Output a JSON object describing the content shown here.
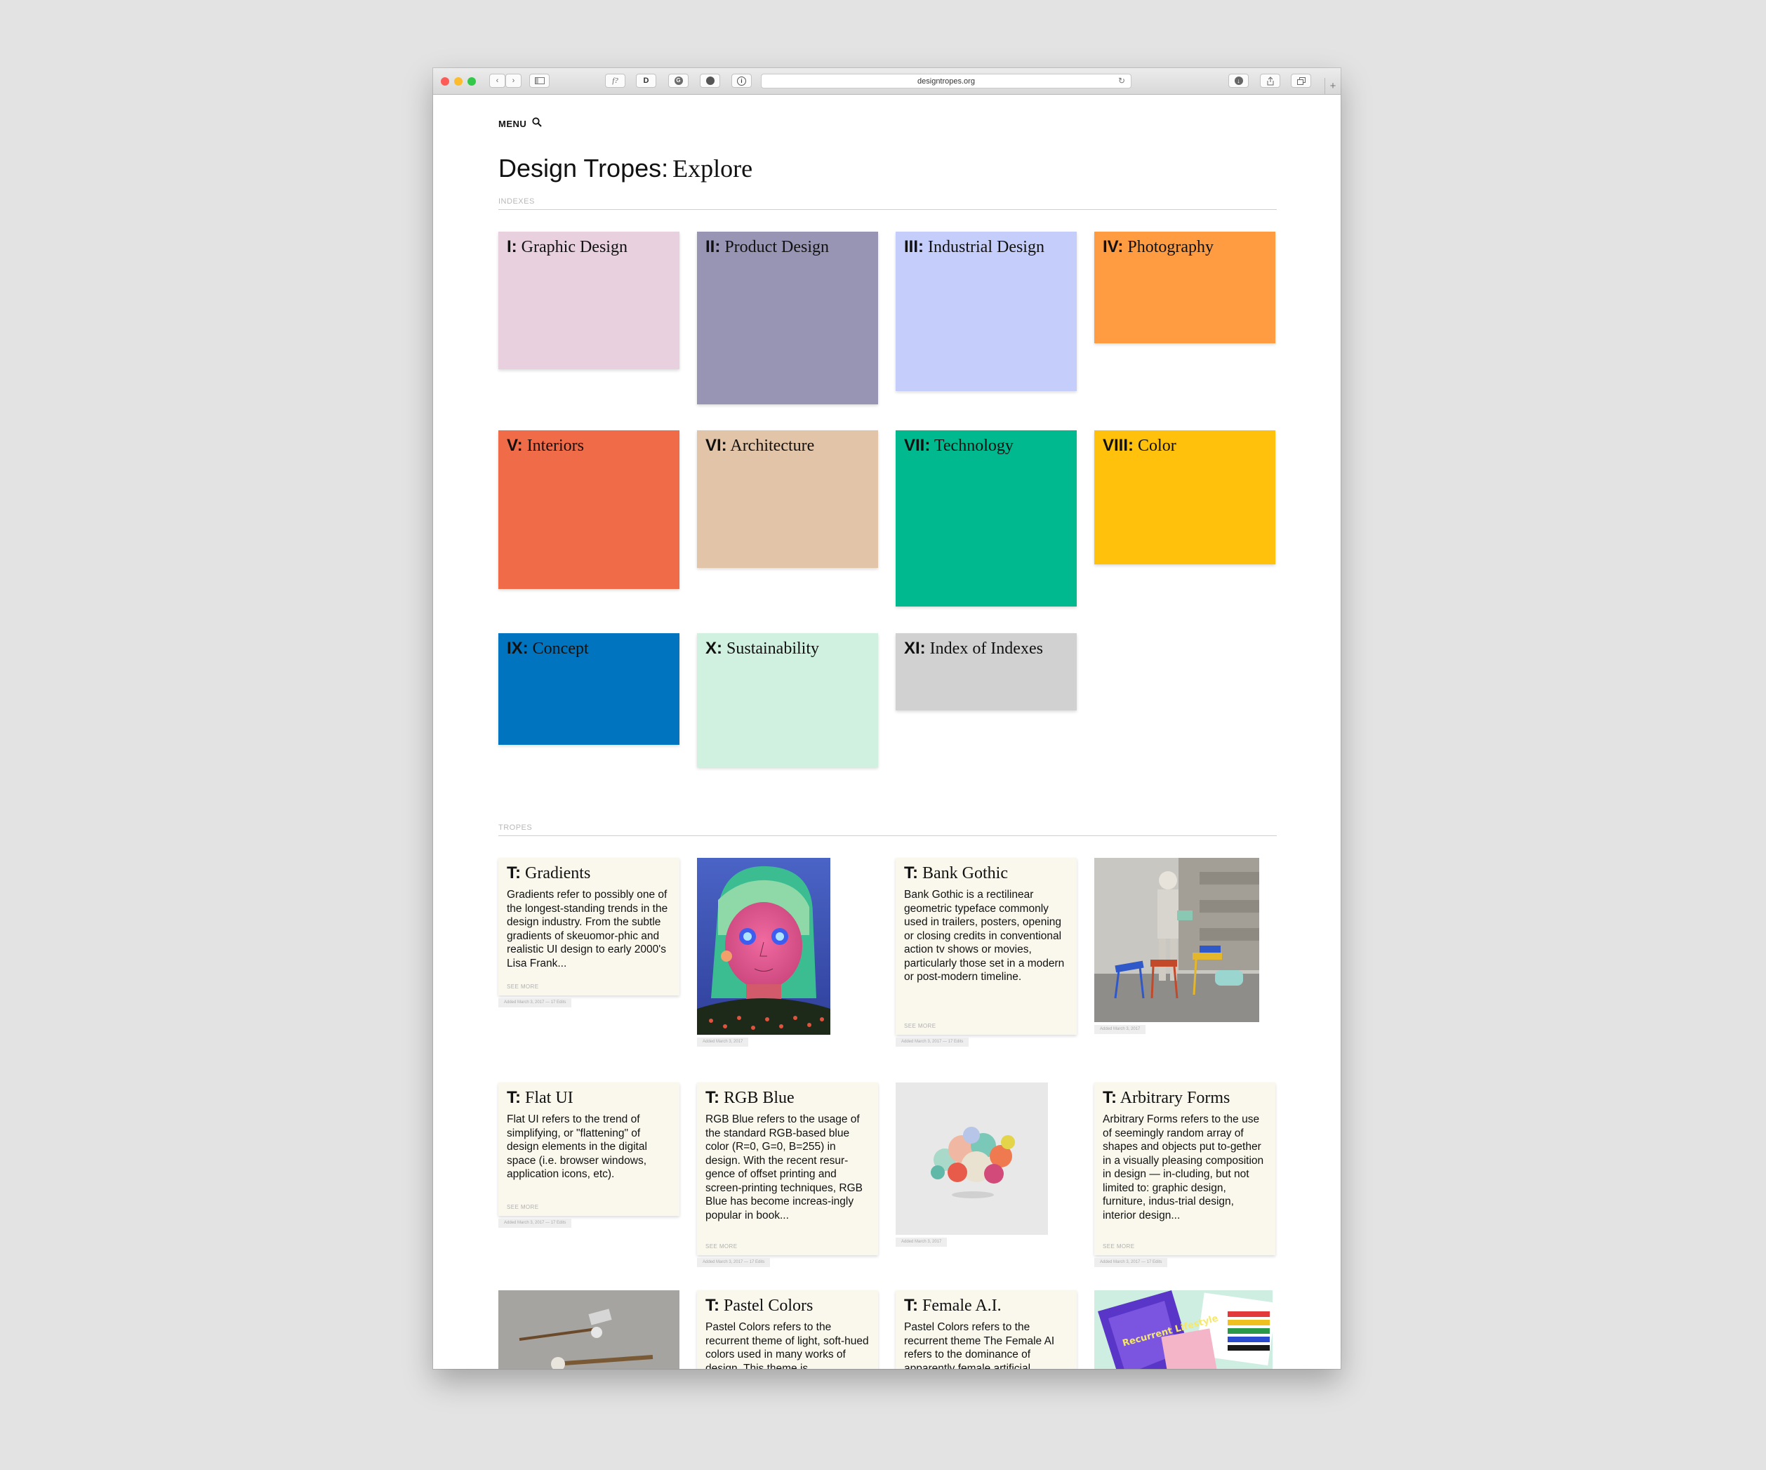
{
  "browser": {
    "url": "designtropes.org",
    "toolbar_icons": [
      "back-icon",
      "forward-icon",
      "sidebar-icon",
      "font-extension-icon",
      "dribbble-extension-icon",
      "grammarly-extension-icon",
      "ghostery-extension-icon",
      "info-extension-icon",
      "reload-icon",
      "download-icon",
      "share-icon",
      "tabs-icon",
      "new-tab-icon"
    ],
    "ext_labels": {
      "font": "f?",
      "d": "D",
      "g": "G",
      "o": "●",
      "i": "i"
    }
  },
  "nav": {
    "menu_label": "MENU"
  },
  "page": {
    "title_sans": "Design Tropes:",
    "title_serif": "Explore"
  },
  "indexes": {
    "label": "INDEXES",
    "items": [
      {
        "numeral": "I:",
        "name": "Graphic Design",
        "color": "#e8d0df"
      },
      {
        "numeral": "II:",
        "name": "Product Design",
        "color": "#9794b4"
      },
      {
        "numeral": "III:",
        "name": "Industrial Design",
        "color": "#c5cdfa"
      },
      {
        "numeral": "IV:",
        "name": "Photography",
        "color": "#ff9b40"
      },
      {
        "numeral": "V:",
        "name": "Interiors",
        "color": "#f06b48"
      },
      {
        "numeral": "VI:",
        "name": "Architecture",
        "color": "#e2c5a9"
      },
      {
        "numeral": "VII:",
        "name": "Technology",
        "color": "#00b98e"
      },
      {
        "numeral": "VIII:",
        "name": "Color",
        "color": "#ffc10c"
      },
      {
        "numeral": "IX:",
        "name": "Concept",
        "color": "#0074bf"
      },
      {
        "numeral": "X:",
        "name": "Sustainability",
        "color": "#d0f1e0"
      },
      {
        "numeral": "XI:",
        "name": "Index of Indexes",
        "color": "#d1d1d1"
      }
    ]
  },
  "tropes": {
    "label": "TROPES",
    "see_more": "SEE MORE",
    "cards": [
      {
        "prefix": "T:",
        "name": "Gradients",
        "body": "Gradients refer to possibly one of the longest-standing trends in the design industry. From the subtle gradients of skeuomor-phic and realistic UI design to early 2000's Lisa Frank...",
        "meta": "Added March 3, 2017 — 17 Edits"
      },
      {
        "prefix": "T:",
        "name": "Bank Gothic",
        "body": "Bank Gothic is a rectilinear geometric typeface commonly used in trailers, posters, opening or closing credits in conventional action tv shows or movies, particularly those set in a modern or post-modern timeline.",
        "meta": "Added March 3, 2017 — 17 Edits"
      },
      {
        "prefix": "T:",
        "name": "Flat UI",
        "body": "Flat UI refers to the trend of simplifying, or \"flattening\" of design elements in the digital space (i.e. browser windows, application icons, etc).",
        "meta": "Added March 3, 2017 — 17 Edits"
      },
      {
        "prefix": "T:",
        "name": "RGB Blue",
        "body": "RGB Blue refers to the usage of the standard RGB-based blue color (R=0, G=0, B=255) in design. With the recent resur-gence of offset printing and screen-printing techniques, RGB Blue has become increas-ingly popular in book...",
        "meta": "Added March 3, 2017 — 17 Edits"
      },
      {
        "prefix": "T:",
        "name": "Arbitrary Forms",
        "body": "Arbitrary Forms refers to the use of seemingly random array of shapes and objects put to-gether in a visually pleasing composition in design — in-cluding, but not limited to: graphic design, furniture, indus-trial design, interior design...",
        "meta": "Added March 3, 2017 — 17 Edits"
      },
      {
        "prefix": "T:",
        "name": "Pastel Colors",
        "body": "Pastel Colors refers to the recurrent theme of light, soft-hued colors used in many works of design. This theme is",
        "meta": ""
      },
      {
        "prefix": "T:",
        "name": "Female A.I.",
        "body": "Pastel Colors refers to the recurrent theme The Female AI refers to the dominance of apparently female artificial",
        "meta": ""
      }
    ],
    "image_meta": [
      "Added March 3, 2017",
      "Added March 3, 2017",
      "Added March 3, 2017"
    ],
    "image_names": [
      "portrait-illustration-image",
      "chairs-photo-image",
      "sculpture-photo-image",
      "tools-photo-image",
      "magazine-photo-image"
    ],
    "magazine_text": "Recurrent Lifestyle"
  }
}
